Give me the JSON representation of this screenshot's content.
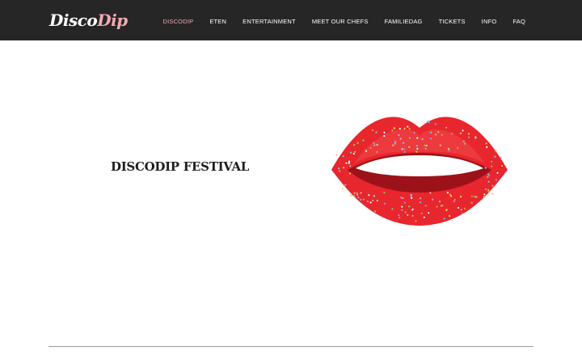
{
  "header": {
    "logo": {
      "part1": "Disco",
      "part2": "Dip"
    },
    "nav": [
      {
        "label": "DISCODIP",
        "active": true
      },
      {
        "label": "ETEN",
        "active": false
      },
      {
        "label": "ENTERTAINMENT",
        "active": false
      },
      {
        "label": "MEET OUR CHEFS",
        "active": false
      },
      {
        "label": "FAMILIEDAG",
        "active": false
      },
      {
        "label": "TICKETS",
        "active": false
      },
      {
        "label": "INFO",
        "active": false
      },
      {
        "label": "FAQ",
        "active": false
      }
    ]
  },
  "hero": {
    "title": "DISCODIP FESTIVAL",
    "image": "lips-with-sprinkles"
  },
  "colors": {
    "header_bg": "#262626",
    "accent": "#f4a9b4",
    "lip_red": "#e8262d"
  }
}
